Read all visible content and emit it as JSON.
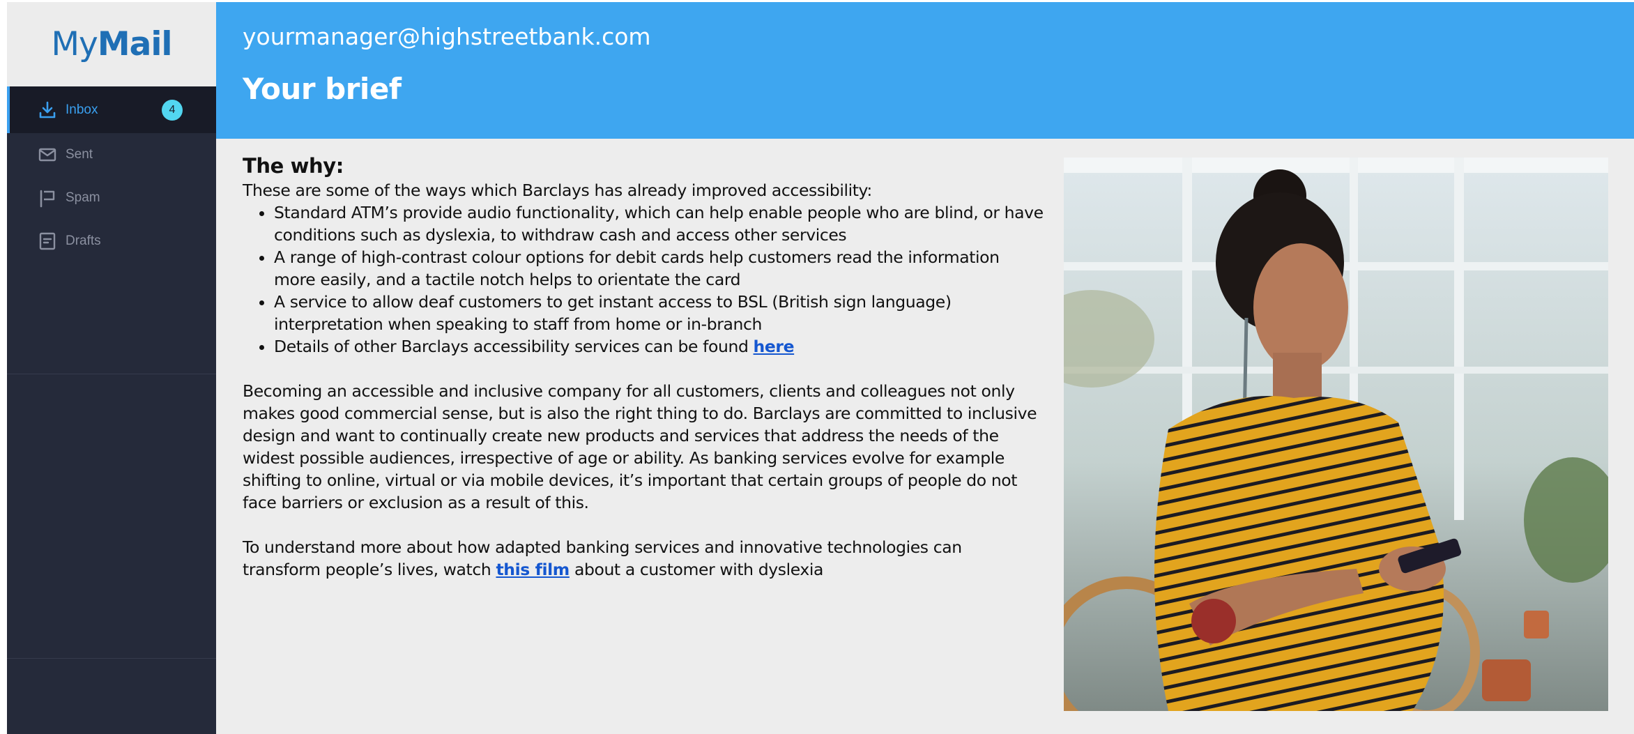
{
  "app": {
    "logo_light": "My",
    "logo_bold": "Mail"
  },
  "sidebar": {
    "items": [
      {
        "label": "Inbox",
        "icon": "download-tray-icon",
        "badge": "4",
        "active": true
      },
      {
        "label": "Sent",
        "icon": "envelope-icon"
      },
      {
        "label": "Spam",
        "icon": "flag-icon"
      },
      {
        "label": "Drafts",
        "icon": "draft-document-icon"
      }
    ]
  },
  "header": {
    "email": "yourmanager@highstreetbank.com",
    "title": "Your brief"
  },
  "message": {
    "heading": "The why:",
    "intro": "These are some of the ways which Barclays has already improved accessibility:",
    "bullets": [
      {
        "text": "Standard ATM’s provide audio functionality, which can help enable people who are blind, or have conditions such as dyslexia, to withdraw cash and access other services"
      },
      {
        "text": "A range of high-contrast colour options for debit cards help customers read the information more easily, and a tactile notch helps to orientate the card"
      },
      {
        "text": "A service to allow deaf customers to get instant access to BSL (British sign language) interpretation when speaking to staff from home or in-branch"
      },
      {
        "text": "Details of other Barclays accessibility services can be found ",
        "link": "here"
      }
    ],
    "paragraph1": "Becoming an accessible and inclusive company for all customers, clients and colleagues not only makes good commercial sense, but is also the right thing to do. Barclays are committed to inclusive design and want to continually create new products and services that address the needs of the widest possible audiences, irrespective of age or ability. As banking services evolve for example shifting to online, virtual or via mobile devices, it’s important that certain groups of people do not face barriers or exclusion as a result of this.",
    "paragraph2_before": "To understand more about how adapted banking services and innovative technologies can transform people’s lives, watch ",
    "paragraph2_link": "this film",
    "paragraph2_after": " about a customer with dyslexia"
  },
  "colors": {
    "header_bg": "#3ea6f0",
    "sidebar_bg": "#252a3a",
    "accent": "#3aa0f0",
    "badge": "#52d6f0",
    "link": "#1557d0"
  }
}
